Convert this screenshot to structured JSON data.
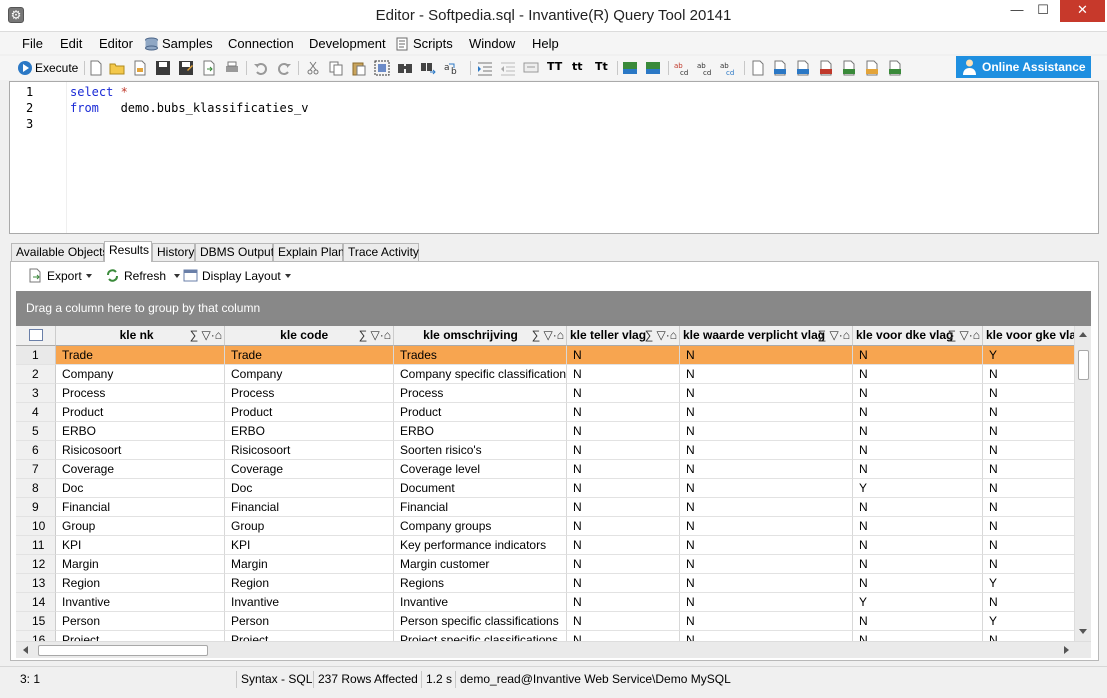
{
  "window": {
    "title": "Editor - Softpedia.sql - Invantive(R) Query Tool 20141",
    "minimize_glyph": "—",
    "maximize_glyph": "☐",
    "close_glyph": "✕"
  },
  "menu": {
    "items": [
      "File",
      "Edit",
      "Editor",
      "Samples",
      "Connection",
      "Development",
      "Scripts",
      "Window",
      "Help"
    ]
  },
  "toolbar": {
    "execute_label": "Execute",
    "online_assistance_label": "Online Assistance"
  },
  "editor": {
    "line_numbers": [
      "1",
      "2",
      "3"
    ],
    "lines": [
      {
        "kw": "select",
        "rest": " *"
      },
      {
        "kw": "from",
        "rest": "   demo.bubs_klassificaties_v"
      },
      {
        "kw": "",
        "rest": ""
      }
    ]
  },
  "tabs": [
    "Available Objects",
    "Results",
    "History",
    "DBMS Output",
    "Explain Plan",
    "Trace Activity"
  ],
  "active_tab": "Results",
  "results_toolbar": {
    "export_label": "Export",
    "refresh_label": "Refresh",
    "display_layout_label": "Display Layout"
  },
  "group_panel_text": "Drag a column here to group by that column",
  "header_icons": "∑ ▽·⌂",
  "grid": {
    "columns": [
      "kle nk",
      "kle code",
      "kle omschrijving",
      "kle teller vlag",
      "kle waarde verplicht vlag",
      "kle voor dke vlag",
      "kle voor gke vlag"
    ],
    "rows": [
      [
        "1",
        "Trade",
        "Trade",
        "Trades",
        "N",
        "N",
        "N",
        "Y"
      ],
      [
        "2",
        "Company",
        "Company",
        "Company specific classifications",
        "N",
        "N",
        "N",
        "N"
      ],
      [
        "3",
        "Process",
        "Process",
        "Process",
        "N",
        "N",
        "N",
        "N"
      ],
      [
        "4",
        "Product",
        "Product",
        "Product",
        "N",
        "N",
        "N",
        "N"
      ],
      [
        "5",
        "ERBO",
        "ERBO",
        "ERBO",
        "N",
        "N",
        "N",
        "N"
      ],
      [
        "6",
        "Risicosoort",
        "Risicosoort",
        "Soorten risico's",
        "N",
        "N",
        "N",
        "N"
      ],
      [
        "7",
        "Coverage",
        "Coverage",
        "Coverage level",
        "N",
        "N",
        "N",
        "N"
      ],
      [
        "8",
        "Doc",
        "Doc",
        "Document",
        "N",
        "N",
        "Y",
        "N"
      ],
      [
        "9",
        "Financial",
        "Financial",
        "Financial",
        "N",
        "N",
        "N",
        "N"
      ],
      [
        "10",
        "Group",
        "Group",
        "Company groups",
        "N",
        "N",
        "N",
        "N"
      ],
      [
        "11",
        "KPI",
        "KPI",
        "Key performance indicators",
        "N",
        "N",
        "N",
        "N"
      ],
      [
        "12",
        "Margin",
        "Margin",
        "Margin customer",
        "N",
        "N",
        "N",
        "N"
      ],
      [
        "13",
        "Region",
        "Region",
        "Regions",
        "N",
        "N",
        "N",
        "Y"
      ],
      [
        "14",
        "Invantive",
        "Invantive",
        "Invantive",
        "N",
        "N",
        "Y",
        "N"
      ],
      [
        "15",
        "Person",
        "Person",
        "Person specific classifications",
        "N",
        "N",
        "N",
        "Y"
      ],
      [
        "16",
        "Project",
        "Project",
        "Project specific classifications",
        "N",
        "N",
        "N",
        "N"
      ]
    ],
    "selected_row_index": 0
  },
  "statusbar": {
    "position": "3: 1",
    "syntax": "Syntax - SQL",
    "rows_affected": "237 Rows Affected",
    "elapsed": "1.2 s",
    "connection": "demo_read@Invantive Web Service\\Demo MySQL"
  },
  "colors": {
    "selected_row": "#f7a550",
    "online_button": "#1e8fe0",
    "keyword": "#1a2ad6",
    "close_button": "#c7392b"
  }
}
